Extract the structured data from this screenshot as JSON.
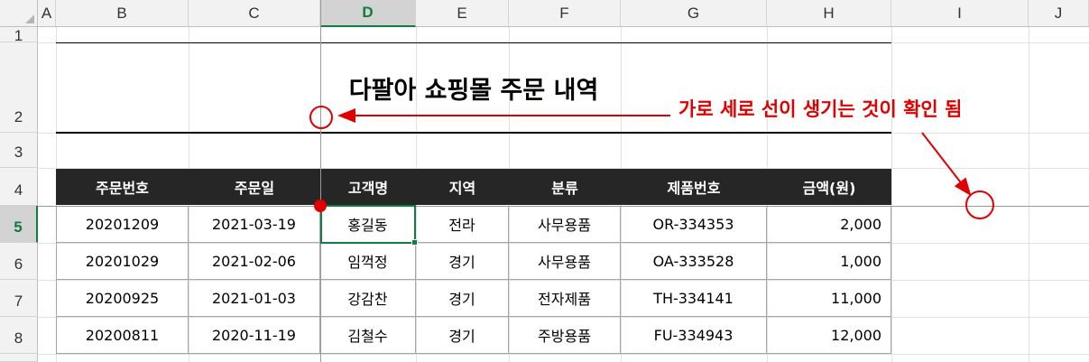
{
  "columns": [
    "A",
    "B",
    "C",
    "D",
    "E",
    "F",
    "G",
    "H",
    "I",
    "J"
  ],
  "selected_column": "D",
  "rows": [
    "1",
    "2",
    "3",
    "4",
    "5",
    "6",
    "7",
    "8"
  ],
  "selected_row": "5",
  "title": "다팔아 쇼핑몰 주문 내역",
  "annotation": "가로 세로 선이 생기는 것이 확인 됨",
  "table": {
    "headers": [
      "주문번호",
      "주문일",
      "고객명",
      "지역",
      "분류",
      "제품번호",
      "금액(원)"
    ],
    "rows": [
      [
        "20201209",
        "2021-03-19",
        "홍길동",
        "전라",
        "사무용품",
        "OR-334353",
        "2,000"
      ],
      [
        "20201029",
        "2021-02-06",
        "임꺽정",
        "경기",
        "사무용품",
        "OA-333528",
        "1,000"
      ],
      [
        "20200925",
        "2021-01-03",
        "강감찬",
        "경기",
        "전자제품",
        "TH-334141",
        "11,000"
      ],
      [
        "20200811",
        "2020-11-19",
        "김철수",
        "경기",
        "주방용품",
        "FU-334943",
        "12,000"
      ]
    ]
  },
  "colors": {
    "accent": "#107c41",
    "annotation": "#e00000",
    "header_bg": "#262626"
  }
}
